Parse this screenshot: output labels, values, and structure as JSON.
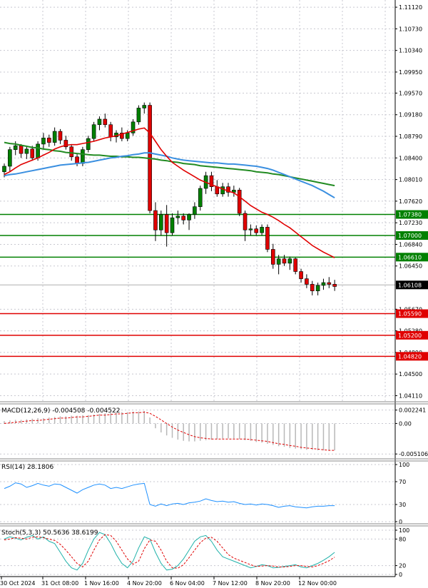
{
  "chart_data": [
    {
      "type": "candlestick",
      "panel": "price",
      "y_ticks": [
        1.1112,
        1.1073,
        1.1034,
        1.0995,
        1.0957,
        1.0918,
        1.0879,
        1.084,
        1.0801,
        1.0762,
        1.0723,
        1.0684,
        1.0645,
        1.0567,
        1.0528,
        1.0489,
        1.045,
        1.0411
      ],
      "y_tick_labels": [
        "1.11120",
        "1.10730",
        "1.10340",
        "1.09950",
        "1.09570",
        "1.09180",
        "1.08790",
        "1.08400",
        "1.08010",
        "1.07620",
        "1.07230",
        "1.06840",
        "1.06450",
        "1.05670",
        "1.05280",
        "1.04890",
        "1.04500",
        "1.04110"
      ],
      "ylim": [
        1.04,
        1.1125
      ],
      "levels": [
        {
          "value": 1.0738,
          "label": "1.07380",
          "color": "#008000"
        },
        {
          "value": 1.07,
          "label": "1.07000",
          "color": "#008000"
        },
        {
          "value": 1.0661,
          "label": "1.06610",
          "color": "#008000"
        },
        {
          "value": 1.0559,
          "label": "1.05590",
          "color": "#e00000"
        },
        {
          "value": 1.052,
          "label": "1.05200",
          "color": "#e00000"
        },
        {
          "value": 1.0482,
          "label": "1.04820",
          "color": "#e00000"
        }
      ],
      "current_price": {
        "value": 1.06108,
        "label": "1.06108"
      },
      "candles": [
        [
          1.0815,
          1.083,
          1.0805,
          1.0825
        ],
        [
          1.0825,
          1.086,
          1.0815,
          1.0855
        ],
        [
          1.0855,
          1.087,
          1.0845,
          1.0862
        ],
        [
          1.0862,
          1.0865,
          1.084,
          1.0848
        ],
        [
          1.0848,
          1.086,
          1.0838,
          1.0856
        ],
        [
          1.0856,
          1.0862,
          1.0835,
          1.084
        ],
        [
          1.084,
          1.087,
          1.0835,
          1.0865
        ],
        [
          1.0865,
          1.0885,
          1.0855,
          1.0876
        ],
        [
          1.0876,
          1.0882,
          1.086,
          1.0868
        ],
        [
          1.0868,
          1.0895,
          1.0862,
          1.0888
        ],
        [
          1.0888,
          1.0892,
          1.0865,
          1.0872
        ],
        [
          1.0872,
          1.088,
          1.0855,
          1.086
        ],
        [
          1.086,
          1.0865,
          1.0835,
          1.0842
        ],
        [
          1.0842,
          1.0848,
          1.0825,
          1.083
        ],
        [
          1.083,
          1.086,
          1.0825,
          1.0855
        ],
        [
          1.0855,
          1.088,
          1.085,
          1.0875
        ],
        [
          1.0875,
          1.0905,
          1.087,
          1.09
        ],
        [
          1.09,
          1.0915,
          1.089,
          1.091
        ],
        [
          1.091,
          1.092,
          1.0895,
          1.09
        ],
        [
          1.09,
          1.0905,
          1.087,
          1.0878
        ],
        [
          1.0878,
          1.089,
          1.0868,
          1.0885
        ],
        [
          1.0885,
          1.0895,
          1.087,
          1.0875
        ],
        [
          1.0875,
          1.089,
          1.087,
          1.0885
        ],
        [
          1.0885,
          1.091,
          1.088,
          1.0905
        ],
        [
          1.0905,
          1.0935,
          1.09,
          1.093
        ],
        [
          1.093,
          1.094,
          1.092,
          1.0935
        ],
        [
          1.0935,
          1.094,
          1.074,
          1.0745
        ],
        [
          1.0745,
          1.076,
          1.069,
          1.071
        ],
        [
          1.071,
          1.0745,
          1.07,
          1.0738
        ],
        [
          1.0738,
          1.0755,
          1.068,
          1.0705
        ],
        [
          1.0705,
          1.074,
          1.07,
          1.0732
        ],
        [
          1.0732,
          1.0745,
          1.072,
          1.0735
        ],
        [
          1.0735,
          1.074,
          1.072,
          1.0728
        ],
        [
          1.0728,
          1.074,
          1.071,
          1.0738
        ],
        [
          1.0738,
          1.076,
          1.073,
          1.0752
        ],
        [
          1.0752,
          1.079,
          1.0745,
          1.0785
        ],
        [
          1.0785,
          1.0815,
          1.0775,
          1.0808
        ],
        [
          1.0808,
          1.0815,
          1.078,
          1.0788
        ],
        [
          1.0788,
          1.08,
          1.077,
          1.0775
        ],
        [
          1.0775,
          1.0795,
          1.077,
          1.0788
        ],
        [
          1.0788,
          1.0795,
          1.077,
          1.0778
        ],
        [
          1.0778,
          1.079,
          1.077,
          1.0782
        ],
        [
          1.0782,
          1.0786,
          1.0735,
          1.074
        ],
        [
          1.074,
          1.0745,
          1.069,
          1.071
        ],
        [
          1.071,
          1.072,
          1.07,
          1.0712
        ],
        [
          1.0712,
          1.0718,
          1.07,
          1.0705
        ],
        [
          1.0705,
          1.072,
          1.07,
          1.0715
        ],
        [
          1.0715,
          1.072,
          1.067,
          1.0675
        ],
        [
          1.0675,
          1.0685,
          1.064,
          1.0648
        ],
        [
          1.0648,
          1.0665,
          1.063,
          1.0658
        ],
        [
          1.0658,
          1.0665,
          1.0645,
          1.065
        ],
        [
          1.065,
          1.0662,
          1.0638,
          1.0658
        ],
        [
          1.0658,
          1.066,
          1.063,
          1.0635
        ],
        [
          1.0635,
          1.064,
          1.0615,
          1.0622
        ],
        [
          1.0622,
          1.063,
          1.0605,
          1.0612
        ],
        [
          1.0612,
          1.0618,
          1.0592,
          1.06
        ],
        [
          1.06,
          1.0615,
          1.0592,
          1.061
        ],
        [
          1.061,
          1.0622,
          1.0602,
          1.0615
        ],
        [
          1.0615,
          1.0625,
          1.0605,
          1.0612
        ],
        [
          1.0612,
          1.062,
          1.06,
          1.0608
        ]
      ],
      "ma_red": [
        1.081,
        1.0815,
        1.0822,
        1.0828,
        1.0832,
        1.0836,
        1.084,
        1.0845,
        1.085,
        1.0856,
        1.086,
        1.0863,
        1.0864,
        1.0864,
        1.0866,
        1.0868,
        1.087,
        1.0873,
        1.0876,
        1.0878,
        1.088,
        1.0883,
        1.0886,
        1.0889,
        1.0892,
        1.0894,
        1.0885,
        1.087,
        1.0855,
        1.0843,
        1.0832,
        1.0825,
        1.0818,
        1.0812,
        1.0806,
        1.08,
        1.0796,
        1.0792,
        1.0788,
        1.0784,
        1.078,
        1.0777,
        1.077,
        1.0762,
        1.0754,
        1.0748,
        1.0742,
        1.0738,
        1.0733,
        1.0727,
        1.072,
        1.0714,
        1.0706,
        1.0698,
        1.069,
        1.0682,
        1.0676,
        1.067,
        1.0665,
        1.066
      ],
      "ma_blue": [
        1.0808,
        1.081,
        1.0811,
        1.0813,
        1.0815,
        1.0817,
        1.0819,
        1.0821,
        1.0823,
        1.0825,
        1.0827,
        1.0828,
        1.0829,
        1.083,
        1.0831,
        1.0832,
        1.0834,
        1.0836,
        1.0838,
        1.084,
        1.0841,
        1.0843,
        1.0844,
        1.0846,
        1.0847,
        1.0849,
        1.0849,
        1.0847,
        1.0845,
        1.0843,
        1.084,
        1.0838,
        1.0836,
        1.0835,
        1.0834,
        1.0833,
        1.0832,
        1.0831,
        1.0831,
        1.083,
        1.0829,
        1.0829,
        1.0828,
        1.0827,
        1.0826,
        1.0825,
        1.0823,
        1.0821,
        1.0818,
        1.0814,
        1.081,
        1.0806,
        1.0802,
        1.0798,
        1.0794,
        1.079,
        1.0785,
        1.078,
        1.0774,
        1.0768
      ],
      "ma_green": [
        1.0868,
        1.0866,
        1.0865,
        1.0863,
        1.0861,
        1.0859,
        1.0858,
        1.0856,
        1.0855,
        1.0853,
        1.0852,
        1.085,
        1.0849,
        1.0848,
        1.0847,
        1.0846,
        1.0845,
        1.0845,
        1.0844,
        1.0843,
        1.0843,
        1.0842,
        1.0842,
        1.0841,
        1.0841,
        1.084,
        1.0839,
        1.0838,
        1.0836,
        1.0835,
        1.0833,
        1.0832,
        1.083,
        1.0829,
        1.0828,
        1.0826,
        1.0825,
        1.0824,
        1.0823,
        1.0822,
        1.0821,
        1.082,
        1.0819,
        1.0818,
        1.0817,
        1.0815,
        1.0814,
        1.0813,
        1.0811,
        1.081,
        1.0808,
        1.0806,
        1.0804,
        1.0802,
        1.08,
        1.0798,
        1.0796,
        1.0794,
        1.0792,
        1.079
      ]
    },
    {
      "type": "bar",
      "panel": "macd",
      "title": "MACD(12,26,9) -0.004508 -0.004522",
      "y_ticks": [
        0.002241,
        0,
        -0.005106
      ],
      "y_tick_labels": [
        "0.002241",
        "0.00",
        "-0.005106"
      ],
      "ylim": [
        -0.0058,
        0.0028
      ],
      "histogram": [
        0.0004,
        0.0005,
        0.0006,
        0.0006,
        0.0007,
        0.0008,
        0.0009,
        0.0009,
        0.001,
        0.0011,
        0.0012,
        0.0012,
        0.0013,
        0.0013,
        0.0014,
        0.0014,
        0.0015,
        0.0016,
        0.0017,
        0.0018,
        0.0018,
        0.0019,
        0.0019,
        0.002,
        0.002,
        0.0021,
        0.001,
        -0.0008,
        -0.0015,
        -0.002,
        -0.0024,
        -0.0027,
        -0.0029,
        -0.003,
        -0.003,
        -0.0029,
        -0.0028,
        -0.0027,
        -0.0026,
        -0.0025,
        -0.0025,
        -0.0025,
        -0.0026,
        -0.0028,
        -0.0029,
        -0.0031,
        -0.0032,
        -0.0034,
        -0.0036,
        -0.0038,
        -0.0039,
        -0.0041,
        -0.0042,
        -0.0043,
        -0.0044,
        -0.0044,
        -0.0045,
        -0.0045,
        -0.0045,
        -0.0045
      ],
      "signal": [
        0.0,
        0.0001,
        0.0002,
        0.0003,
        0.0004,
        0.0005,
        0.0005,
        0.0006,
        0.0007,
        0.0008,
        0.0009,
        0.0009,
        0.001,
        0.0011,
        0.0011,
        0.0012,
        0.0013,
        0.0014,
        0.0014,
        0.0015,
        0.0016,
        0.0016,
        0.0017,
        0.0018,
        0.0018,
        0.0019,
        0.0017,
        0.0012,
        0.0006,
        0.0,
        -0.0006,
        -0.0011,
        -0.0015,
        -0.0019,
        -0.0022,
        -0.0024,
        -0.0025,
        -0.0026,
        -0.0026,
        -0.0026,
        -0.0026,
        -0.0026,
        -0.0026,
        -0.0026,
        -0.0027,
        -0.0028,
        -0.0029,
        -0.003,
        -0.0032,
        -0.0034,
        -0.0035,
        -0.0037,
        -0.0038,
        -0.004,
        -0.0041,
        -0.0042,
        -0.0043,
        -0.0044,
        -0.0045,
        -0.0045
      ]
    },
    {
      "type": "line",
      "panel": "rsi",
      "title": "RSI(14) 28.1806",
      "y_ticks": [
        100,
        70,
        30,
        0
      ],
      "y_tick_labels": [
        "100",
        "70",
        "30",
        "0"
      ],
      "ylim": [
        0,
        100
      ],
      "values": [
        58,
        62,
        68,
        66,
        60,
        63,
        67,
        64,
        62,
        66,
        65,
        60,
        55,
        50,
        56,
        60,
        64,
        66,
        64,
        58,
        60,
        58,
        61,
        64,
        66,
        67,
        30,
        27,
        31,
        28,
        31,
        32,
        30,
        33,
        34,
        36,
        40,
        37,
        35,
        36,
        34,
        35,
        32,
        30,
        31,
        29,
        31,
        30,
        28,
        25,
        27,
        28,
        26,
        25,
        24,
        26,
        27,
        27,
        28,
        28
      ]
    },
    {
      "type": "line",
      "panel": "stoch",
      "title": "Stoch(5,3,3) 50.5636 38.6199",
      "y_ticks": [
        100,
        80,
        20,
        0
      ],
      "y_tick_labels": [
        "100",
        "80",
        "20",
        "0"
      ],
      "ylim": [
        0,
        100
      ],
      "k": [
        80,
        85,
        82,
        78,
        84,
        88,
        80,
        85,
        75,
        70,
        50,
        30,
        15,
        10,
        25,
        55,
        80,
        95,
        90,
        70,
        45,
        25,
        15,
        30,
        60,
        85,
        80,
        50,
        25,
        10,
        12,
        20,
        35,
        55,
        75,
        85,
        88,
        75,
        55,
        40,
        35,
        30,
        25,
        20,
        15,
        18,
        22,
        20,
        15,
        16,
        18,
        20,
        22,
        17,
        15,
        20,
        25,
        32,
        40,
        50
      ],
      "d": [
        78,
        80,
        83,
        82,
        80,
        84,
        85,
        83,
        80,
        77,
        68,
        55,
        40,
        25,
        17,
        30,
        55,
        78,
        90,
        88,
        75,
        55,
        35,
        23,
        30,
        58,
        78,
        75,
        55,
        30,
        15,
        14,
        22,
        38,
        55,
        72,
        82,
        84,
        75,
        60,
        45,
        37,
        32,
        27,
        22,
        18,
        19,
        20,
        19,
        17,
        17,
        18,
        20,
        20,
        18,
        17,
        20,
        25,
        31,
        39
      ]
    },
    {
      "type": "axis",
      "panel": "time",
      "x_tick_labels": [
        "30 Oct 2024",
        "31 Oct 08:00",
        "1 Nov 16:00",
        "4 Nov 20:00",
        "6 Nov 04:00",
        "7 Nov 12:00",
        "8 Nov 20:00",
        "12 Nov 00:00"
      ]
    }
  ]
}
